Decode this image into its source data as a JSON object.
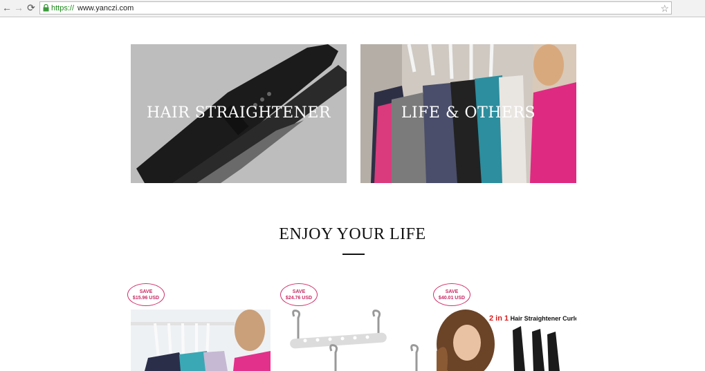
{
  "browser": {
    "back_icon": "←",
    "forward_icon": "→",
    "reload_icon": "⟳",
    "url_scheme": "https://",
    "url_host": "www.yanczi.com",
    "bookmark_icon": "☆"
  },
  "categories": [
    {
      "label": "HAIR STRAIGHTENER"
    },
    {
      "label": "LIFE & OTHERS"
    }
  ],
  "section": {
    "title": "ENJOY YOUR LIFE"
  },
  "products": [
    {
      "save_label": "SAVE",
      "save_amount": "$15.96 USD"
    },
    {
      "save_label": "SAVE",
      "save_amount": "$24.76 USD"
    },
    {
      "save_label": "SAVE",
      "save_amount": "$40.01 USD",
      "image_text_highlight": "2 in 1",
      "image_text": " Hair Straightener Curler"
    }
  ],
  "colors": {
    "accent": "#c62862",
    "url_green": "#1a8a1a"
  }
}
